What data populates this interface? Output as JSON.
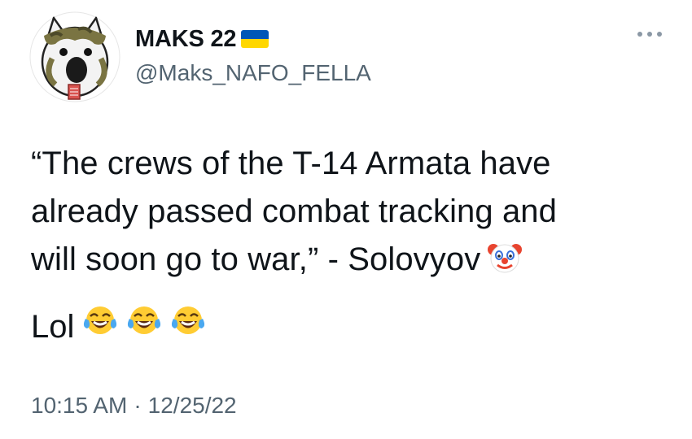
{
  "user": {
    "display_name": "MAKS 22",
    "handle": "@Maks_NAFO_FELLA",
    "flag_icon": "ukraine-flag-icon",
    "avatar_icon": "nafo-shiba-avatar"
  },
  "tweet": {
    "lines": [
      "“The crews of the T-14 Armata have",
      "already passed combat tracking and",
      "will soon go to war,” - Solovyov"
    ],
    "trailing_emoji": "clown-face-emoji",
    "reaction_text": "Lol",
    "reaction_emojis": [
      "tears-of-joy-emoji",
      "tears-of-joy-emoji",
      "tears-of-joy-emoji"
    ]
  },
  "meta": {
    "time": "10:15 AM",
    "separator": "·",
    "date": "12/25/22"
  },
  "colors": {
    "text": "#0f1419",
    "secondary": "#536471",
    "flag_blue": "#0057b7",
    "flag_yellow": "#ffd700"
  }
}
